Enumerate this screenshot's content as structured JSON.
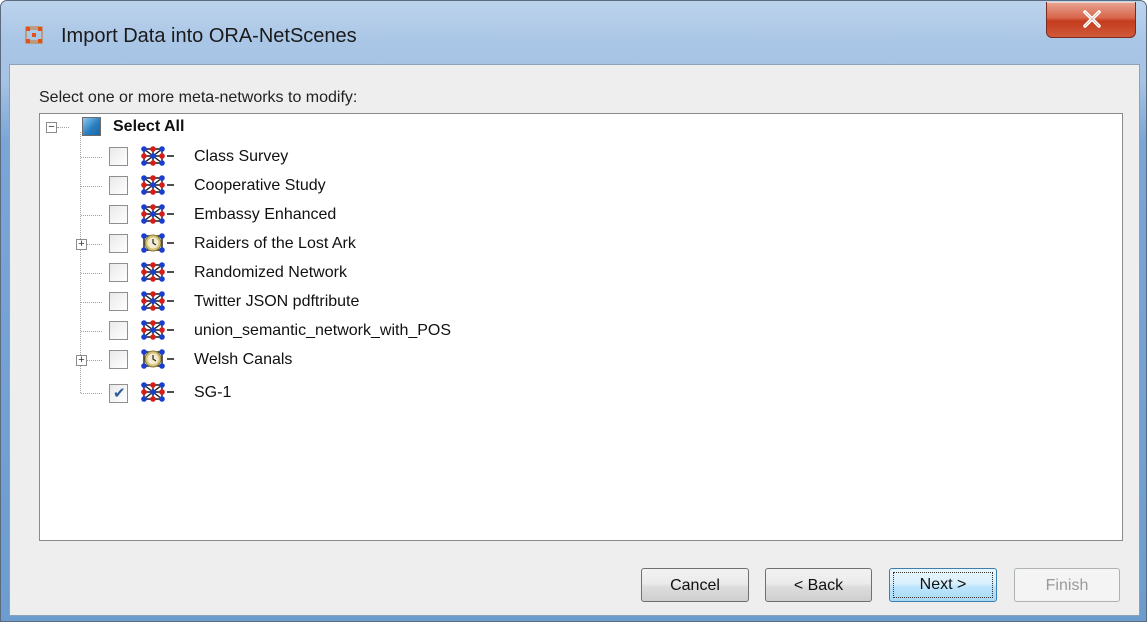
{
  "window": {
    "title": "Import Data into ORA-NetScenes",
    "close_label": "X"
  },
  "dialog": {
    "prompt": "Select one or more meta-networks to modify:"
  },
  "tree": {
    "root": {
      "label": "Select All",
      "expander": "−",
      "state": "partial"
    },
    "items": [
      {
        "label": "Class Survey",
        "icon": "meta-network-icon",
        "checked": false,
        "expandable": false
      },
      {
        "label": "Cooperative Study",
        "icon": "meta-network-icon",
        "checked": false,
        "expandable": false
      },
      {
        "label": "Embassy Enhanced",
        "icon": "meta-network-icon",
        "checked": false,
        "expandable": false
      },
      {
        "label": "Raiders of the Lost Ark",
        "icon": "dynamic-meta-network-icon",
        "checked": false,
        "expandable": true,
        "expander": "+"
      },
      {
        "label": "Randomized Network",
        "icon": "meta-network-icon",
        "checked": false,
        "expandable": false
      },
      {
        "label": "Twitter JSON pdftribute",
        "icon": "meta-network-icon",
        "checked": false,
        "expandable": false
      },
      {
        "label": "union_semantic_network_with_POS",
        "icon": "meta-network-icon",
        "checked": false,
        "expandable": false
      },
      {
        "label": "Welsh Canals",
        "icon": "dynamic-meta-network-icon",
        "checked": false,
        "expandable": true,
        "expander": "+"
      },
      {
        "label": "SG-1",
        "icon": "meta-network-icon",
        "checked": true,
        "expandable": false
      }
    ]
  },
  "buttons": {
    "cancel": "Cancel",
    "back": "< Back",
    "next": "Next >",
    "finish": "Finish"
  },
  "colors": {
    "title_bar": "#aac6e6",
    "close_button": "#c43b1d",
    "dialog_background": "#eeeeee",
    "node_blue": "#1a3fd0",
    "node_red": "#d81c1c",
    "select_all_fill": "#2a7fc1",
    "check_mark": "#2b5f9e"
  }
}
